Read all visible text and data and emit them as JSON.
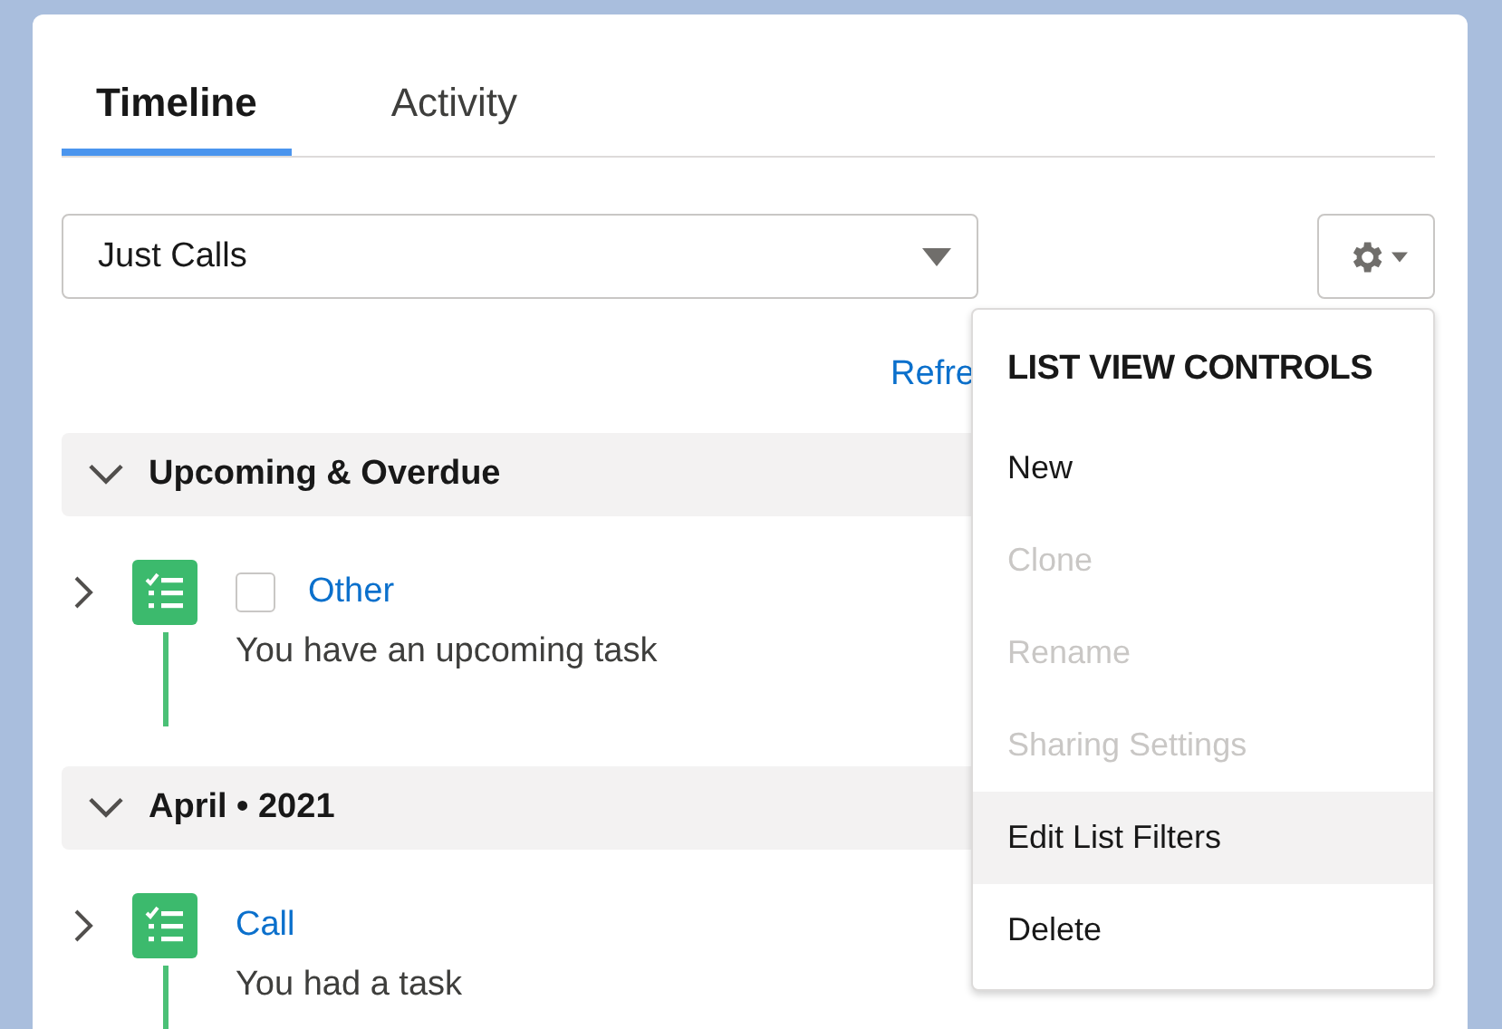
{
  "tabs": [
    {
      "label": "Timeline",
      "selected": true
    },
    {
      "label": "Activity",
      "selected": false
    }
  ],
  "filter": {
    "value": "Just Calls"
  },
  "refresh_link": "Refre",
  "list_view_controls": {
    "title": "LIST VIEW CONTROLS",
    "items": [
      {
        "label": "New",
        "disabled": false,
        "highlighted": false
      },
      {
        "label": "Clone",
        "disabled": true,
        "highlighted": false
      },
      {
        "label": "Rename",
        "disabled": true,
        "highlighted": false
      },
      {
        "label": "Sharing Settings",
        "disabled": true,
        "highlighted": false
      },
      {
        "label": "Edit List Filters",
        "disabled": false,
        "highlighted": true
      },
      {
        "label": "Delete",
        "disabled": false,
        "highlighted": false
      }
    ]
  },
  "sections": [
    {
      "title": "Upcoming & Overdue",
      "expanded": true,
      "items": [
        {
          "title": "Other",
          "description": "You have an upcoming task",
          "checked": false,
          "expanded": false
        }
      ]
    },
    {
      "title": "April • 2021",
      "expanded": true,
      "items": [
        {
          "title": "Call",
          "description": "You had a task",
          "expanded": false
        }
      ]
    }
  ]
}
